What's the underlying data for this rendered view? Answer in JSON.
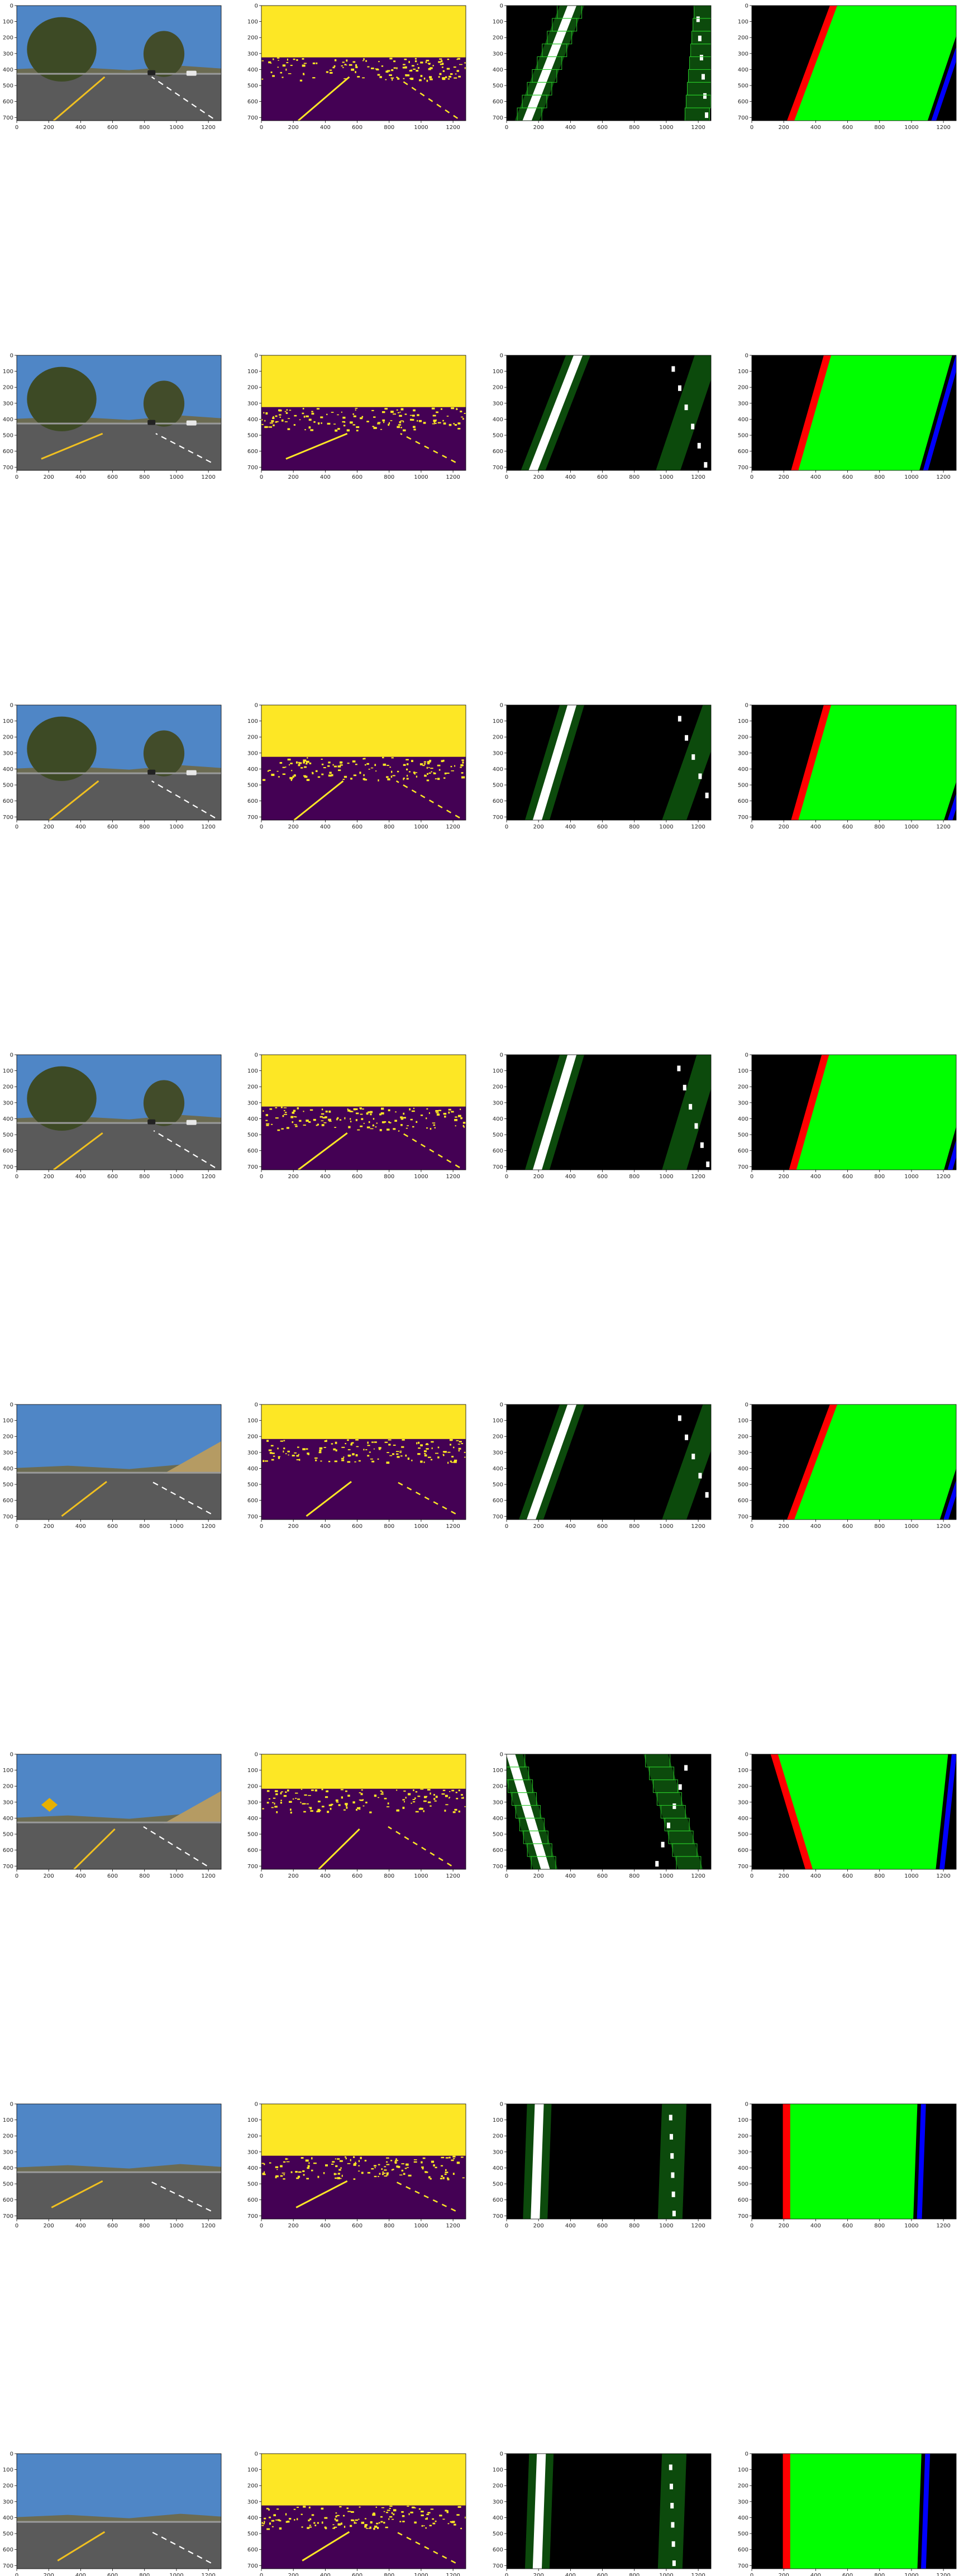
{
  "chart_data": {
    "type": "image-grid",
    "rows": 8,
    "cols": 4,
    "panel_types": [
      "road-photo",
      "binary-threshold",
      "lane-window-search",
      "lane-overlay"
    ],
    "xticks": [
      "0",
      "200",
      "400",
      "600",
      "800",
      "1000",
      "1200"
    ],
    "yticks": [
      "0",
      "100",
      "200",
      "300",
      "400",
      "500",
      "600",
      "700"
    ],
    "xlim": [
      0,
      1280
    ],
    "ylim": [
      720,
      0
    ],
    "grid": false,
    "colors": {
      "sky": "#4f86c6",
      "road": "#5a5a5a",
      "threshold_low": "#440154",
      "threshold_high": "#fde725",
      "search_band": "#0c4a0c",
      "window_box": "#28c828",
      "lane_fill": "#00ff00",
      "left_lane": "#ff0000",
      "right_lane": "#0000ff",
      "lane_line_yellow": "#f0c020",
      "lane_line_white": "#ffffff"
    },
    "photo_lanes": [
      {
        "left": [
          [
            0.18,
            1.0
          ],
          [
            0.43,
            0.62
          ]
        ],
        "right": [
          [
            0.96,
            0.98
          ],
          [
            0.66,
            0.62
          ]
        ]
      },
      {
        "left": [
          [
            0.12,
            0.9
          ],
          [
            0.42,
            0.68
          ]
        ],
        "right": [
          [
            0.95,
            0.93
          ],
          [
            0.68,
            0.68
          ]
        ]
      },
      {
        "left": [
          [
            0.16,
            1.0
          ],
          [
            0.4,
            0.66
          ]
        ],
        "right": [
          [
            0.97,
            0.98
          ],
          [
            0.66,
            0.66
          ]
        ]
      },
      {
        "left": [
          [
            0.18,
            1.0
          ],
          [
            0.42,
            0.68
          ]
        ],
        "right": [
          [
            0.97,
            0.98
          ],
          [
            0.67,
            0.66
          ]
        ]
      },
      {
        "left": [
          [
            0.22,
            0.97
          ],
          [
            0.44,
            0.67
          ]
        ],
        "right": [
          [
            0.95,
            0.95
          ],
          [
            0.66,
            0.67
          ]
        ]
      },
      {
        "left": [
          [
            0.28,
            1.0
          ],
          [
            0.48,
            0.65
          ]
        ],
        "right": [
          [
            0.93,
            0.97
          ],
          [
            0.62,
            0.63
          ]
        ]
      },
      {
        "left": [
          [
            0.17,
            0.9
          ],
          [
            0.42,
            0.67
          ]
        ],
        "right": [
          [
            0.95,
            0.93
          ],
          [
            0.65,
            0.67
          ]
        ]
      },
      {
        "left": [
          [
            0.2,
            0.93
          ],
          [
            0.43,
            0.68
          ]
        ],
        "right": [
          [
            0.95,
            0.95
          ],
          [
            0.66,
            0.68
          ]
        ]
      }
    ],
    "search_bands": [
      {
        "left": [
          [
            0.1,
            1.0
          ],
          [
            0.32,
            0.0
          ]
        ],
        "right": [
          [
            0.93,
            1.0
          ],
          [
            0.98,
            0.0
          ]
        ],
        "windows": true
      },
      {
        "left": [
          [
            0.13,
            1.0
          ],
          [
            0.35,
            0.0
          ]
        ],
        "right": [
          [
            0.79,
            1.0
          ],
          [
            0.98,
            0.0
          ]
        ],
        "windows": false
      },
      {
        "left": [
          [
            0.15,
            1.0
          ],
          [
            0.32,
            0.0
          ]
        ],
        "right": [
          [
            0.82,
            1.0
          ],
          [
            1.02,
            0.0
          ]
        ],
        "windows": false
      },
      {
        "left": [
          [
            0.15,
            1.0
          ],
          [
            0.32,
            0.0
          ]
        ],
        "right": [
          [
            0.82,
            1.0
          ],
          [
            0.99,
            0.0
          ]
        ],
        "windows": false
      },
      {
        "left": [
          [
            0.12,
            1.0
          ],
          [
            0.32,
            0.0
          ]
        ],
        "right": [
          [
            0.82,
            1.0
          ],
          [
            1.02,
            0.0
          ]
        ],
        "windows": false
      },
      {
        "left": [
          [
            0.19,
            1.0
          ],
          [
            0.02,
            0.0
          ]
        ],
        "right": [
          [
            0.9,
            1.0
          ],
          [
            0.73,
            0.0
          ]
        ],
        "windows": true
      },
      {
        "left": [
          [
            0.14,
            1.0
          ],
          [
            0.16,
            0.0
          ]
        ],
        "right": [
          [
            0.8,
            1.0
          ],
          [
            0.82,
            0.0
          ]
        ],
        "windows": false
      },
      {
        "left": [
          [
            0.15,
            1.0
          ],
          [
            0.17,
            0.0
          ]
        ],
        "right": [
          [
            0.8,
            1.0
          ],
          [
            0.82,
            0.0
          ]
        ],
        "windows": false
      }
    ],
    "overlays": [
      {
        "left": [
          [
            0.19,
            1.0
          ],
          [
            0.4,
            0.0
          ]
        ],
        "right": [
          [
            0.86,
            1.0
          ],
          [
            1.05,
            0.0
          ]
        ]
      },
      {
        "left": [
          [
            0.21,
            1.0
          ],
          [
            0.37,
            0.0
          ]
        ],
        "right": [
          [
            0.82,
            1.0
          ],
          [
            0.98,
            0.0
          ]
        ]
      },
      {
        "left": [
          [
            0.21,
            1.0
          ],
          [
            0.37,
            0.0
          ]
        ],
        "right": [
          [
            0.94,
            1.0
          ],
          [
            1.12,
            0.0
          ]
        ]
      },
      {
        "left": [
          [
            0.2,
            1.0
          ],
          [
            0.36,
            0.0
          ]
        ],
        "right": [
          [
            0.94,
            1.0
          ],
          [
            1.1,
            0.0
          ]
        ]
      },
      {
        "left": [
          [
            0.19,
            1.0
          ],
          [
            0.4,
            0.0
          ]
        ],
        "right": [
          [
            0.92,
            1.0
          ],
          [
            1.1,
            0.0
          ]
        ]
      },
      {
        "left": [
          [
            0.28,
            1.0
          ],
          [
            0.11,
            0.0
          ]
        ],
        "right": [
          [
            0.9,
            1.0
          ],
          [
            0.96,
            0.0
          ]
        ]
      },
      {
        "left": [
          [
            0.17,
            1.0
          ],
          [
            0.17,
            0.0
          ]
        ],
        "right": [
          [
            0.79,
            1.0
          ],
          [
            0.81,
            0.0
          ]
        ]
      },
      {
        "left": [
          [
            0.17,
            1.0
          ],
          [
            0.17,
            0.0
          ]
        ],
        "right": [
          [
            0.81,
            1.0
          ],
          [
            0.83,
            0.0
          ]
        ]
      }
    ]
  }
}
